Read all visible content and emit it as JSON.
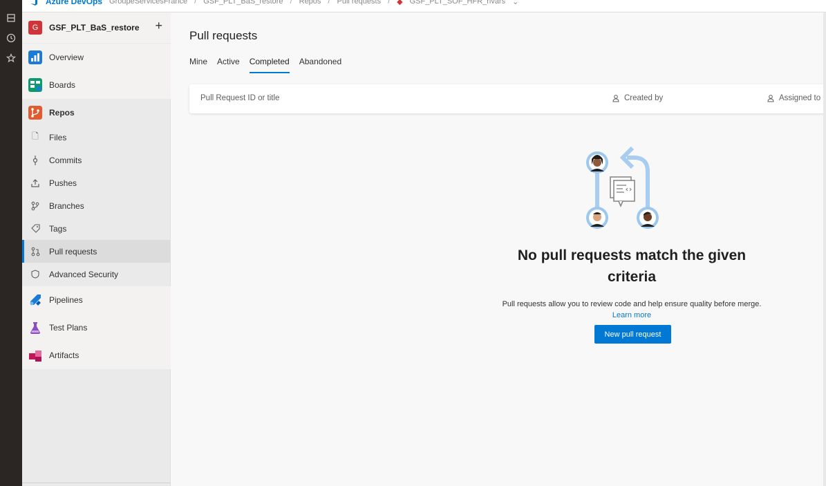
{
  "breadcrumbs": {
    "brand": "Azure DevOps",
    "items": [
      "GroupeServicesFrance",
      "GSF_PLT_BaS_restore",
      "Repos",
      "Pull requests",
      "GSF_PLT_SOF_HFR_rivars"
    ]
  },
  "project": {
    "badge": "G",
    "name": "GSF_PLT_BaS_restore",
    "add": "+"
  },
  "nav": {
    "overview": "Overview",
    "boards": "Boards",
    "repos": "Repos",
    "files": "Files",
    "commits": "Commits",
    "pushes": "Pushes",
    "branches": "Branches",
    "tags": "Tags",
    "pull_requests": "Pull requests",
    "advanced_security": "Advanced Security",
    "pipelines": "Pipelines",
    "test_plans": "Test Plans",
    "artifacts": "Artifacts"
  },
  "page": {
    "title": "Pull requests",
    "tabs": [
      "Mine",
      "Active",
      "Completed",
      "Abandoned"
    ],
    "active_tab": "Completed"
  },
  "filter": {
    "placeholder": "Pull Request ID or title",
    "created_by": "Created by",
    "assigned_to": "Assigned to"
  },
  "empty_state": {
    "title": "No pull requests match the given criteria",
    "description": "Pull requests allow you to review code and help ensure quality before merge.",
    "learn_more": "Learn more",
    "button": "New pull request"
  },
  "colors": {
    "accent": "#0078d4",
    "project_badge": "#d13438"
  }
}
